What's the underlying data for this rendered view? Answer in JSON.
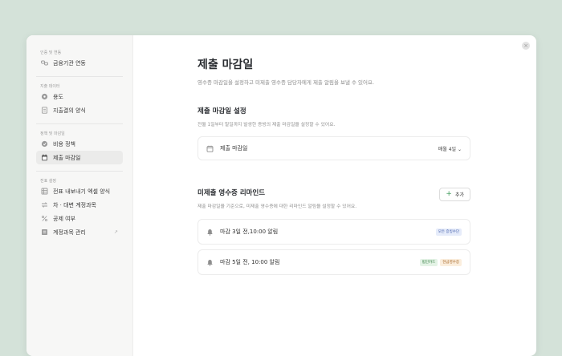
{
  "sidebar": {
    "sections": [
      {
        "title": "인증 및 연동",
        "items": [
          {
            "label": "금융기관 연동",
            "icon": "link-icon"
          }
        ]
      },
      {
        "title": "지출 데이터",
        "items": [
          {
            "label": "용도",
            "icon": "tag-icon"
          },
          {
            "label": "지출결의 양식",
            "icon": "document-icon"
          }
        ]
      },
      {
        "title": "정책 및 마감일",
        "items": [
          {
            "label": "비용 정책",
            "icon": "policy-icon"
          },
          {
            "label": "제출 마감일",
            "icon": "calendar-icon",
            "active": true
          }
        ]
      },
      {
        "title": "전표 설정",
        "items": [
          {
            "label": "전표 내보내기 엑셀 양식",
            "icon": "table-icon"
          },
          {
            "label": "차 · 대변 계정과목",
            "icon": "swap-icon"
          },
          {
            "label": "공제 여부",
            "icon": "percent-icon"
          },
          {
            "label": "계정과목 관리",
            "icon": "ledger-icon"
          }
        ]
      }
    ]
  },
  "main": {
    "title": "제출 마감일",
    "subtitle": "영수증 마감일을 설정하고 미제출 영수증 담당자에게 제출 알림을 보낼 수 있어요.",
    "deadline": {
      "heading": "제출 마감일 설정",
      "desc": "전월 1일부터 말일까지 발생한 증빙의 제출 마감일을 설정할 수 있어요.",
      "row_label": "제출 마감일",
      "select_value": "매월 4일",
      "select_chevron": "⌄"
    },
    "reminder": {
      "heading": "미제출 영수증 리마인드",
      "desc": "제출 마감일을 기준으로, 미제출 영수증에 대한 리마인드 알림을 설정할 수 있어요.",
      "add_label": "추가",
      "add_plus": "+",
      "items": [
        {
          "label": "마감 3일 전,10:00 알림",
          "badges": [
            "모든 증빙수단"
          ]
        },
        {
          "label": "마감 5일 전, 10:00 알림",
          "badges": [
            "법인카드",
            "현금영수증"
          ]
        }
      ]
    }
  },
  "close_glyph": "×",
  "external_glyph": "↗",
  "colors": {
    "background": "#d4e2d9",
    "accent_green": "#3f9a5a"
  }
}
